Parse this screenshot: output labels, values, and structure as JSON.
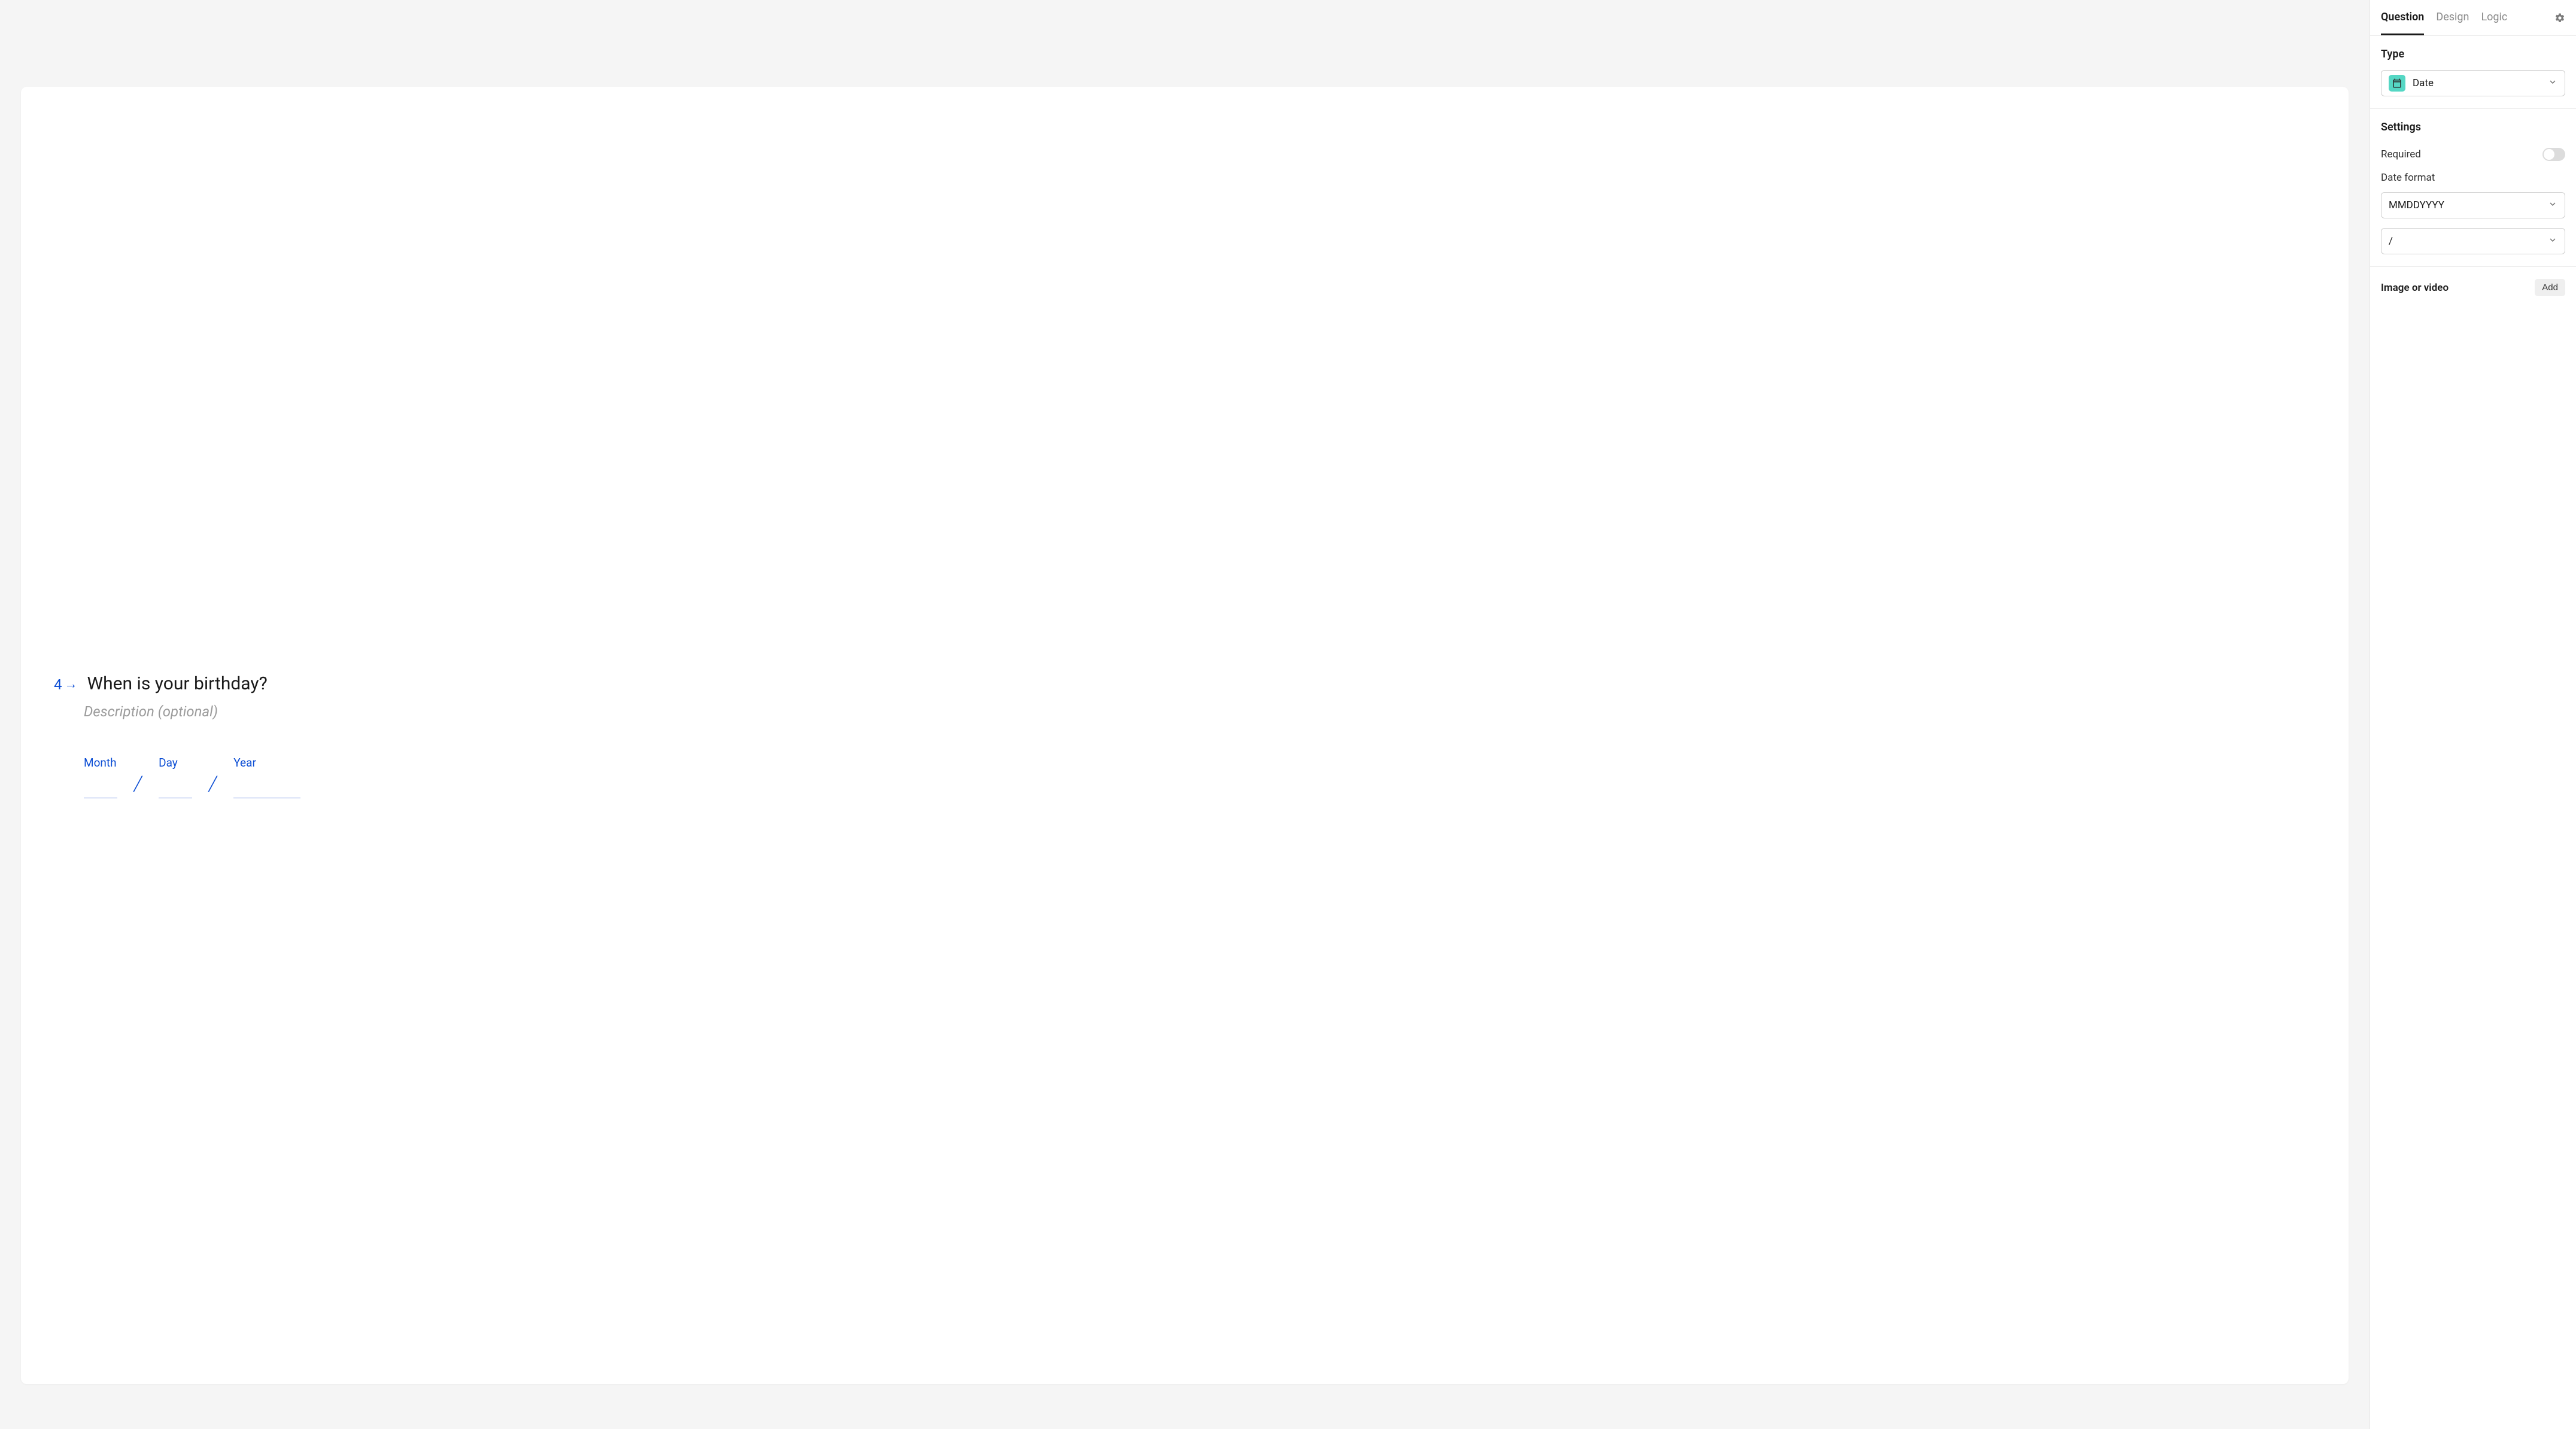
{
  "canvas": {
    "question_number": "4",
    "title": "When is your birthday?",
    "description_placeholder": "Description (optional)",
    "date": {
      "month_label": "Month",
      "day_label": "Day",
      "year_label": "Year",
      "separator": "/"
    }
  },
  "panel": {
    "tabs": {
      "question": "Question",
      "design": "Design",
      "logic": "Logic"
    },
    "type_section": {
      "title": "Type",
      "selected": "Date"
    },
    "settings_section": {
      "title": "Settings",
      "required_label": "Required",
      "required_on": false,
      "date_format_label": "Date format",
      "date_format_value": "MMDDYYYY",
      "date_separator_value": "/"
    },
    "media_section": {
      "label": "Image or video",
      "add_button": "Add"
    }
  }
}
